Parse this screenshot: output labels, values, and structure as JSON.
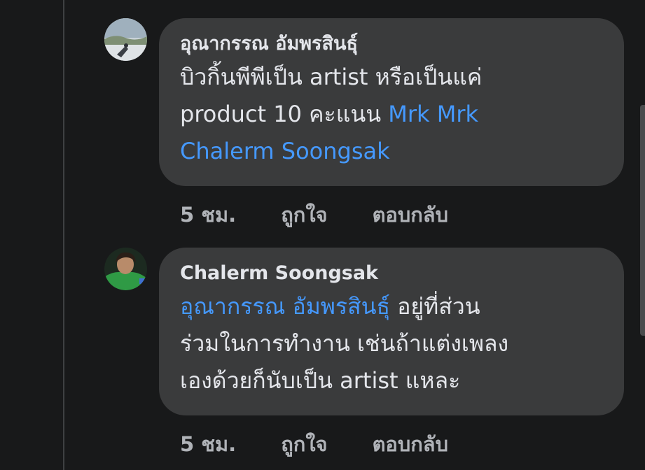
{
  "comments": [
    {
      "author": "อุณากรรณ อัมพรสินธุ์",
      "text_line1": "บิวกิ้นพีพีเป็น artist หรือเป็นแค่",
      "text_line2_plain": "product 10 คะแนน ",
      "mention_1a": "Mrk Mrk",
      "mention_1b": "Chalerm Soongsak",
      "time": "5 ชม.",
      "like_label": "ถูกใจ",
      "reply_label": "ตอบกลับ"
    },
    {
      "author": "Chalerm Soongsak",
      "mention": "อุณากรรณ อัมพรสินธุ์",
      "text_line1_rest": " อยู่ที่ส่วน",
      "text_line2": "ร่วมในการทำงาน เช่นถ้าแต่งเพลง",
      "text_line3": "เองด้วยก็นับเป็น artist แหละ",
      "time": "5 ชม.",
      "like_label": "ถูกใจ",
      "reply_label": "ตอบกลับ"
    }
  ],
  "colors": {
    "background": "#18191a",
    "bubble": "#3a3b3c",
    "text": "#e4e6eb",
    "secondary": "#b0b3b8",
    "mention": "#4599ff"
  }
}
